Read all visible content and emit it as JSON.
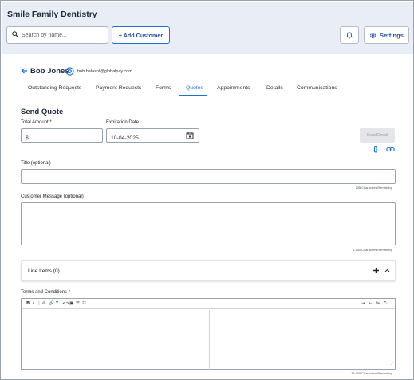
{
  "app": {
    "title": "Smile Family Dentistry"
  },
  "header": {
    "search_placeholder": "Search by name...",
    "add_customer_label": "+ Add Customer",
    "settings_label": "Settings"
  },
  "customer": {
    "name": "Bob Jones",
    "email": "bob.balasol@globalpay.com"
  },
  "tabs": [
    {
      "label": "Outstanding Requests",
      "active": false
    },
    {
      "label": "Payment Requests",
      "active": false
    },
    {
      "label": "Forms",
      "active": false
    },
    {
      "label": "Quotes",
      "active": true
    },
    {
      "label": "Appointments",
      "active": false
    },
    {
      "label": "Details",
      "active": false
    },
    {
      "label": "Communications",
      "active": false
    }
  ],
  "form": {
    "section_title": "Send Quote",
    "total_amount_label": "Total Amount *",
    "total_amount_value": "$",
    "expiration_date_label": "Expiration Date",
    "expiration_date_value": "10-04-2025",
    "send_email_label": "Send Email",
    "title_label": "Title (optional)",
    "title_remaining": "255 Characters Remaining",
    "message_label": "Customer Message (optional)",
    "message_remaining": "1,000 Characters Remaining",
    "line_items_label": "Line Items (0)",
    "terms_label": "Terms and Conditions *",
    "terms_remaining": "15,000 Characters Remaining"
  },
  "toolbar": {
    "left": [
      "B",
      "I",
      "|",
      "⊘",
      "🔗",
      "❞",
      "<>",
      "▣",
      "☰",
      "☷"
    ],
    "right": [
      "⇥",
      "⇤",
      "↹",
      "⤡"
    ]
  },
  "icons": {
    "search": "search-icon",
    "bell": "bell-icon",
    "gear": "gear-icon",
    "back": "arrow-left-icon",
    "at": "at-icon",
    "calendar": "calendar-icon",
    "clip": "paperclip-icon",
    "link": "link-icon",
    "plus": "plus-icon",
    "chevron": "chevron-up-icon"
  },
  "colors": {
    "accent": "#1f6fd1",
    "header_bg": "#e9eef6",
    "text_dark": "#1e2a3b"
  }
}
